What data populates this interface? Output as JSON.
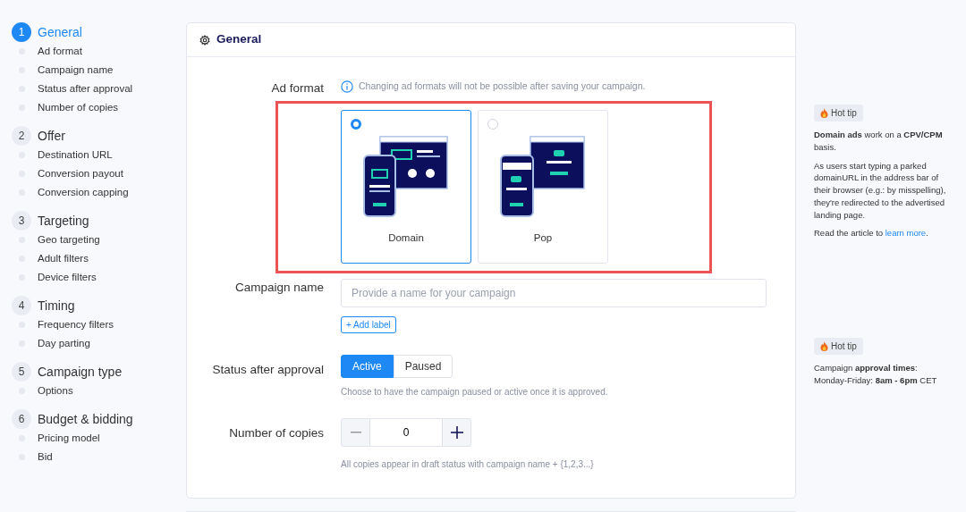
{
  "sidebar": {
    "sections": [
      {
        "number": "1",
        "title": "General",
        "selected": true,
        "items": [
          "Ad format",
          "Campaign name",
          "Status after approval",
          "Number of copies"
        ]
      },
      {
        "number": "2",
        "title": "Offer",
        "selected": false,
        "items": [
          "Destination URL",
          "Conversion payout",
          "Conversion capping"
        ]
      },
      {
        "number": "3",
        "title": "Targeting",
        "selected": false,
        "items": [
          "Geo targeting",
          "Adult filters",
          "Device filters"
        ]
      },
      {
        "number": "4",
        "title": "Timing",
        "selected": false,
        "items": [
          "Frequency filters",
          "Day parting"
        ]
      },
      {
        "number": "5",
        "title": "Campaign type",
        "selected": false,
        "items": [
          "Options"
        ]
      },
      {
        "number": "6",
        "title": "Budget & bidding",
        "selected": false,
        "items": [
          "Pricing model",
          "Bid"
        ]
      }
    ]
  },
  "card": {
    "title": "General",
    "ad_format": {
      "label": "Ad format",
      "info": "Changing ad formats will not be possible after saving your campaign.",
      "highlighted": true,
      "options": [
        {
          "label": "Domain",
          "selected": true,
          "kind": "domain"
        },
        {
          "label": "Pop",
          "selected": false,
          "kind": "pop"
        }
      ]
    },
    "campaign_name": {
      "label": "Campaign name",
      "placeholder": "Provide a name for your campaign",
      "add_label": "+ Add label"
    },
    "status": {
      "label": "Status after approval",
      "options": [
        {
          "label": "Active",
          "selected": true
        },
        {
          "label": "Paused",
          "selected": false
        }
      ],
      "help": "Choose to have the campaign paused or active once it is approved."
    },
    "copies": {
      "label": "Number of copies",
      "value": "0",
      "help": "All copies appear in draft status with campaign name + {1,2,3...}"
    }
  },
  "tips": [
    {
      "badge": "Hot tip",
      "paragraphs": [
        {
          "text": "**Domain ads** work on a **CPV/CPM** basis."
        },
        {
          "text": "As users start typing a parked domainURL in the address bar of their browser (e.g.: by misspelling), they're redirected to the advertised landing page."
        },
        {
          "text": "Read the article to ",
          "link": "learn more",
          "end": "."
        }
      ]
    },
    {
      "badge": "Hot tip",
      "paragraphs": [
        {
          "text": "Campaign **approval times**: Monday-Friday: **8am - 6pm** CET"
        }
      ]
    }
  ]
}
